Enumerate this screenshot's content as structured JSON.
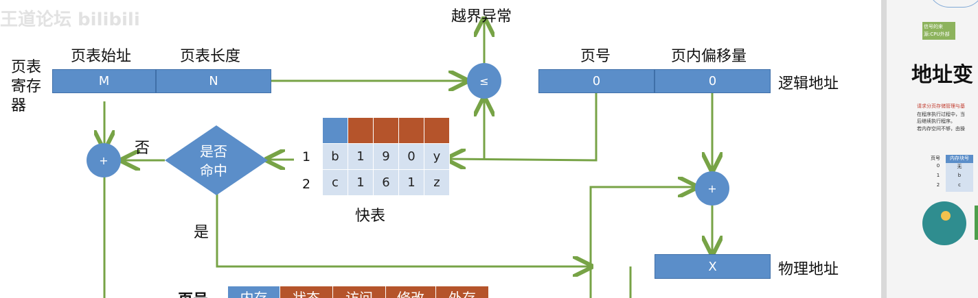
{
  "watermark": "王道论坛 bilibili",
  "labels": {
    "ptr": "页表\n寄存\n器",
    "ptr_start": "页表始址",
    "ptr_len": "页表长度",
    "out_of_bounds": "越界异常",
    "page_no": "页号",
    "offset": "页内偏移量",
    "logical_addr": "逻辑地址",
    "physical_addr": "物理地址",
    "tlb": "快表",
    "no": "否",
    "yes": "是",
    "hit": "是否\n命中",
    "bottom_page_no": "页号"
  },
  "boxes": {
    "m": "M",
    "n": "N",
    "page_val": "0",
    "offset_val": "0",
    "x": "X"
  },
  "ops": {
    "compare": "≤",
    "plus": "+"
  },
  "tlb": {
    "rows": [
      {
        "index": "1",
        "cells": [
          "b",
          "1",
          "9",
          "0",
          "y"
        ]
      },
      {
        "index": "2",
        "cells": [
          "c",
          "1",
          "6",
          "1",
          "z"
        ]
      }
    ]
  },
  "bottom_headers": [
    "内存",
    "状态",
    "访问",
    "修改",
    "外存"
  ],
  "side": {
    "caption": "信号的来源:CPU外部",
    "title": "地址变",
    "p1": "请求分页存储管理与基",
    "p2": "在程序执行过程中，当",
    "p3": "后继续执行程序。",
    "p4": "若内存空间不够，由操",
    "table_head": [
      "页号",
      "内存块号"
    ],
    "table_rows": [
      [
        "0",
        "无"
      ],
      [
        "1",
        "b"
      ],
      [
        "2",
        "c"
      ]
    ]
  },
  "colors": {
    "box": "#5b8ec9",
    "accent": "#b5542b",
    "arrow": "#77a346",
    "cell": "#d5e1f0"
  }
}
